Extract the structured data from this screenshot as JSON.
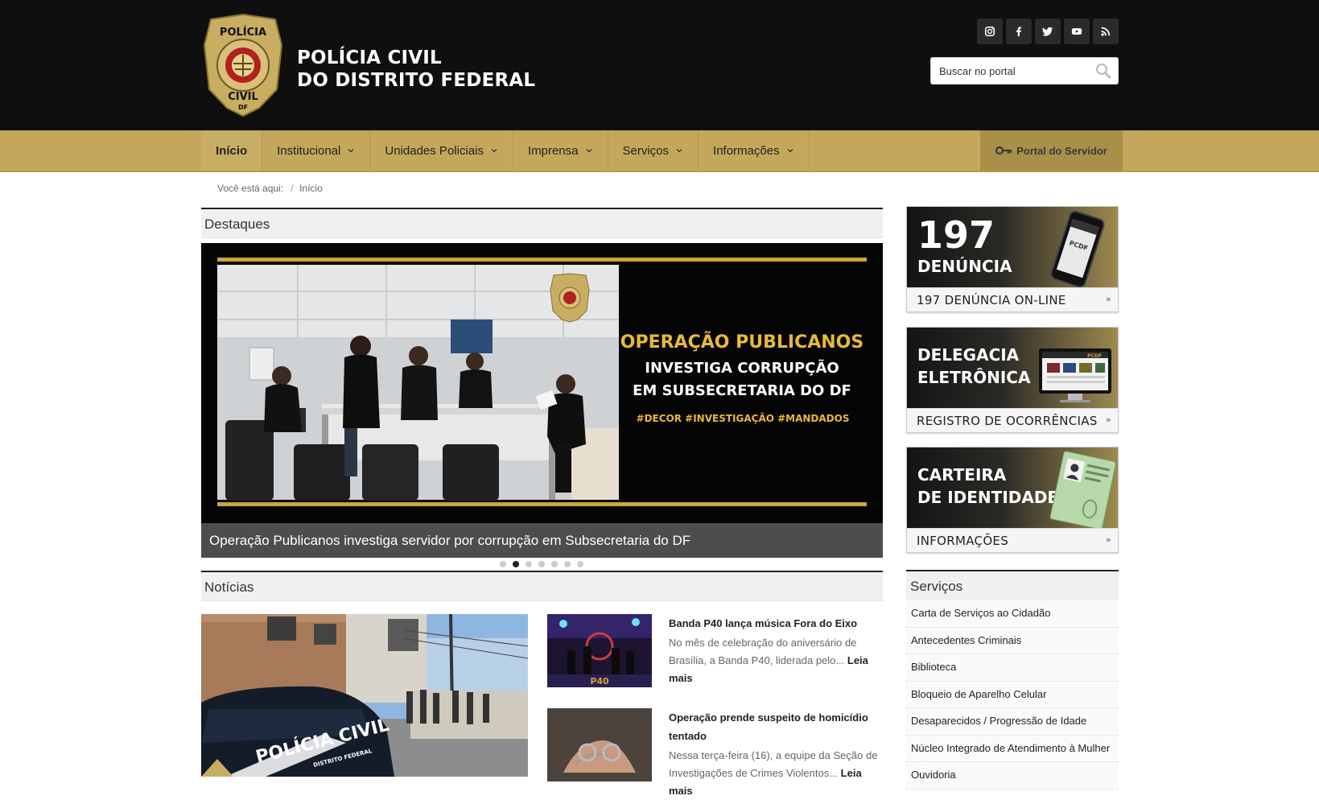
{
  "header": {
    "badge_text_top": "POLÍCIA",
    "badge_text_bottom": "CIVIL",
    "badge_text_df": "DF",
    "title_line1": "POLÍCIA CIVIL",
    "title_line2": "DO DISTRITO FEDERAL",
    "socials": [
      "instagram-icon",
      "facebook-icon",
      "twitter-icon",
      "youtube-icon",
      "rss-icon"
    ],
    "search_placeholder": "Buscar no portal"
  },
  "nav": {
    "items": [
      {
        "label": "Início",
        "active": true,
        "dropdown": false
      },
      {
        "label": "Institucional",
        "dropdown": true
      },
      {
        "label": "Unidades Policiais",
        "dropdown": true
      },
      {
        "label": "Imprensa",
        "dropdown": true
      },
      {
        "label": "Serviços",
        "dropdown": true
      },
      {
        "label": "Informações",
        "dropdown": true
      }
    ],
    "servidor_label": "Portal do Servidor"
  },
  "breadcrumb": {
    "prefix": "Você está aqui:",
    "sep": "/",
    "current": "Início"
  },
  "destaques": {
    "heading": "Destaques",
    "slide_headline_1": "OPERAÇÃO PUBLICANOS",
    "slide_headline_2": "INVESTIGA CORRUPÇÃO",
    "slide_headline_3": "EM SUBSECRETARIA  DO DF",
    "slide_tags": "#DECOR #INVESTIGAÇÃO #MANDADOS",
    "caption": "Operação Publicanos investiga servidor por corrupção em Subsecretaria do DF",
    "dots_total": 7,
    "dots_active": 2
  },
  "noticias": {
    "heading": "Notícias",
    "main_photo_text": "POLÍCIA CIVIL",
    "main_photo_subtext": "DISTRITO FEDERAL",
    "items": [
      {
        "title": "Banda P40 lança música Fora do Eixo",
        "summary": "No mês de celebração do aniversário de Brasília, a Banda P40, liderada pelo...",
        "more": "Leia mais",
        "thumb_text": "P40"
      },
      {
        "title": "Operação prende suspeito de homicídio tentado",
        "summary": "Nessa terça-feira (16), a equipe da Seção de Investigações de Crimes Violentos...",
        "more": "Leia mais"
      }
    ]
  },
  "sidebar": {
    "banners": [
      {
        "line1": "197",
        "line2": "DENÚNCIA",
        "footer": "197 DENÚNCIA ON-LINE",
        "screen_text": "PCDF"
      },
      {
        "line1": "DELEGACIA",
        "line2": "ELETRÔNICA",
        "footer": "REGISTRO DE OCORRÊNCIAS",
        "screen_text": "PCDF"
      },
      {
        "line1": "CARTEIRA",
        "line2": "DE IDENTIDADE",
        "footer": "INFORMAÇÕES"
      }
    ],
    "banner_arrow": "»",
    "servicos_heading": "Serviços",
    "servicos": [
      "Carta de Serviços ao Cidadão",
      "Antecedentes Criminais",
      "Biblioteca",
      "Bloqueio de Aparelho Celular",
      "Desaparecidos / Progressão de Idade",
      "Núcleo Integrado de Atendimento à Mulher",
      "Ouvidoria"
    ]
  },
  "colors": {
    "header_bg": "#0f0f0f",
    "nav_gold": "#c3a85c",
    "servidor_bg": "#a98f48",
    "slide_text_gold": "#e8b93a",
    "caption_bg": "#4d4d4d"
  }
}
